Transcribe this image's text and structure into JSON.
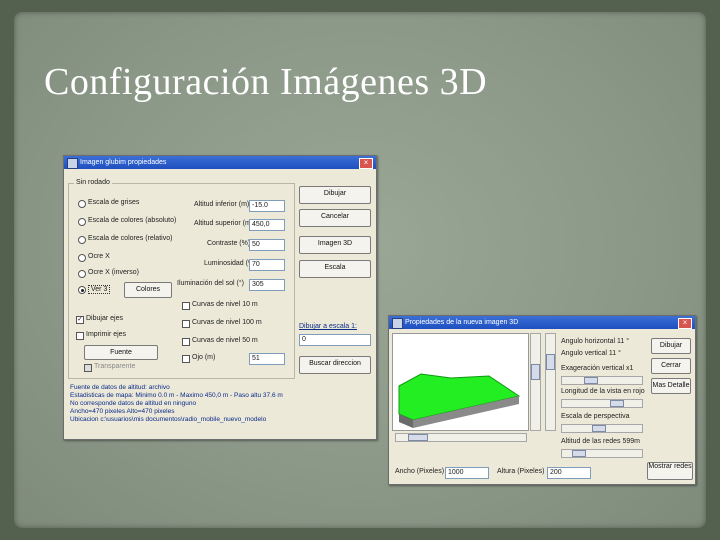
{
  "slide": {
    "title": "Configuración Imágenes 3D"
  },
  "win1": {
    "title": "Imagen glubim propiedades",
    "group_label": "Sin rodado",
    "radios": [
      {
        "label": "Escala de grises",
        "on": false
      },
      {
        "label": "Escala de colores (absoluto)",
        "on": false
      },
      {
        "label": "Escala de colores (relativo)",
        "on": false
      },
      {
        "label": "Ocre X",
        "on": false
      },
      {
        "label": "Ocre X (inverso)",
        "on": false
      },
      {
        "label": "Ver 3",
        "on": true
      }
    ],
    "colores_button": "Colores",
    "fields": [
      {
        "label": "Altitud inferior (m)",
        "value": "-15.0"
      },
      {
        "label": "Altitud superior (m)",
        "value": "450,0"
      },
      {
        "label": "Contraste (%)",
        "value": "50"
      },
      {
        "label": "Luminosidad (%)",
        "value": "70"
      },
      {
        "label": "Iluminación del sol (°)",
        "value": "305"
      }
    ],
    "side_buttons": [
      "Dibujar",
      "Cancelar",
      "Imagen 3D",
      "Escala"
    ],
    "checks_left": [
      {
        "label": "Dibujar ejes",
        "on": true
      },
      {
        "label": "Imprimir ejes",
        "on": false
      }
    ],
    "fuente_button": "Fuente",
    "transparent_label": "Transparente",
    "checks_right": [
      {
        "label": "Curvas de nivel 10 m",
        "on": false
      },
      {
        "label": "Curvas de nivel 100 m",
        "on": false
      },
      {
        "label": "Curvas de nivel 50 m",
        "on": false
      },
      {
        "label": "Ojo (m)",
        "on": false
      }
    ],
    "ojo_value": "51",
    "dibujar_label": "Dibujar a escala 1:",
    "dibujar_value": "0",
    "buscar_button": "Buscar direccion",
    "info_lines": [
      "Fuente de datos de altitud: archivo",
      "Estadisticas de mapa: Minimo 0.0 m - Maximo 450,0 m - Paso altu 37.6 m",
      "No corresponde datos de altitud en ninguno",
      "Ancho=470 pixeles Alto=470 pixeles",
      "Ubicacion c:\\usuarios\\mis documentos\\radio_mobile_nuevo_modelo"
    ]
  },
  "win2": {
    "title": "Propiedades de la nueva imagen 3D",
    "labels": [
      "Angulo horizontal 11 °",
      "Angulo vertical 11 °",
      "Exageración vertical x1",
      "Longitud de la vista en rojo",
      "Escala de perspectiva",
      "Altitud de las redes 599m"
    ],
    "buttons": [
      "Dibujar",
      "Cerrar",
      "Mas Detalle"
    ],
    "bottom_button": "Mostrar redes",
    "ancho_label": "Ancho (Pixeles)",
    "ancho_value": "1000",
    "alto_label": "Altura (Pixeles)",
    "alto_value": "200"
  },
  "colors": {
    "terrain": "#22ee22",
    "titlebar": "#2a5bd0"
  }
}
